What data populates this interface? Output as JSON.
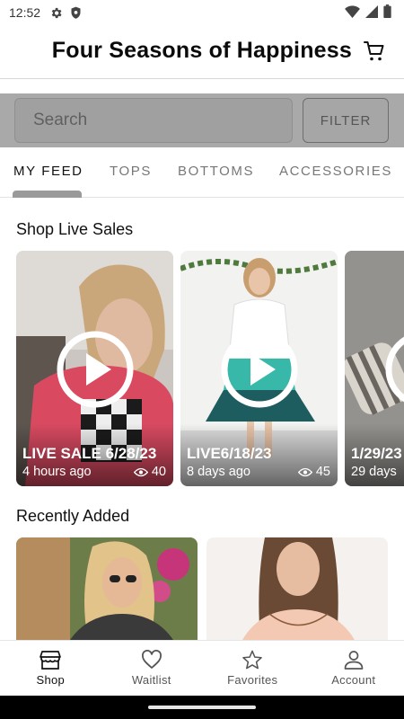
{
  "status_bar": {
    "time": "12:52"
  },
  "header": {
    "title": "Four Seasons of Happiness",
    "cart_icon": "cart-icon"
  },
  "search": {
    "placeholder": "Search",
    "value": "",
    "filter_label": "FILTER"
  },
  "tabs": [
    {
      "label": "MY FEED",
      "active": true
    },
    {
      "label": "TOPS",
      "active": false
    },
    {
      "label": "BOTTOMS",
      "active": false
    },
    {
      "label": "ACCESSORIES",
      "active": false
    }
  ],
  "live_section": {
    "title": "Shop Live Sales",
    "cards": [
      {
        "title": "LIVE SALE 6/28/23",
        "ago": "4 hours ago",
        "views": "40"
      },
      {
        "title": "LIVE6/18/23",
        "ago": "8 days ago",
        "views": "45"
      },
      {
        "title": "1/29/23",
        "ago": "29 days",
        "views": ""
      }
    ]
  },
  "recent_section": {
    "title": "Recently Added"
  },
  "bottom_nav": [
    {
      "label": "Shop",
      "icon": "store-icon",
      "active": true
    },
    {
      "label": "Waitlist",
      "icon": "heart-icon",
      "active": false
    },
    {
      "label": "Favorites",
      "icon": "star-icon",
      "active": false
    },
    {
      "label": "Account",
      "icon": "person-icon",
      "active": false
    }
  ],
  "colors": {
    "search_band": "#a9a9a9",
    "tab_indicator": "#9a9a9a",
    "text": "#111111"
  }
}
